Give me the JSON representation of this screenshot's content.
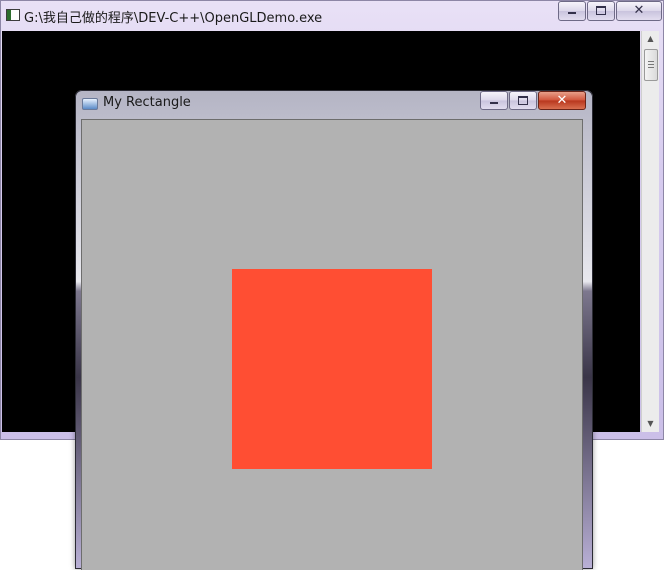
{
  "console_window": {
    "title": "G:\\我自己做的程序\\DEV-C++\\OpenGLDemo.exe",
    "caption_buttons": {
      "minimize": "",
      "maximize": "",
      "close": "✕"
    },
    "background_color": "#000000"
  },
  "gl_window": {
    "title": "My Rectangle",
    "caption_buttons": {
      "minimize": "",
      "maximize": "",
      "close": "✕"
    },
    "clear_color": "#b2b2b2",
    "rectangle_color": "#ff4e33"
  },
  "icons": {
    "console_app": "console-app-icon",
    "gl_app": "opengl-app-icon",
    "scroll_up": "scroll-up-arrow-icon",
    "scroll_down": "scroll-down-arrow-icon"
  }
}
